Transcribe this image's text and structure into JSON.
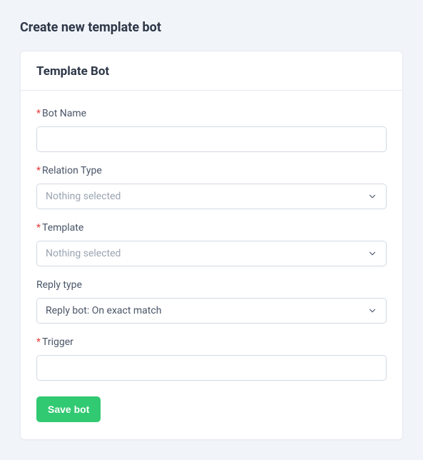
{
  "page": {
    "title": "Create new template bot"
  },
  "card": {
    "title": "Template Bot"
  },
  "fields": {
    "botName": {
      "label": "Bot Name",
      "required": true,
      "value": ""
    },
    "relationType": {
      "label": "Relation Type",
      "required": true,
      "placeholder": "Nothing selected"
    },
    "template": {
      "label": "Template",
      "required": true,
      "placeholder": "Nothing selected"
    },
    "replyType": {
      "label": "Reply type",
      "required": false,
      "value": "Reply bot: On exact match"
    },
    "trigger": {
      "label": "Trigger",
      "required": true,
      "value": ""
    }
  },
  "actions": {
    "save": "Save bot"
  },
  "symbols": {
    "required": "*"
  }
}
